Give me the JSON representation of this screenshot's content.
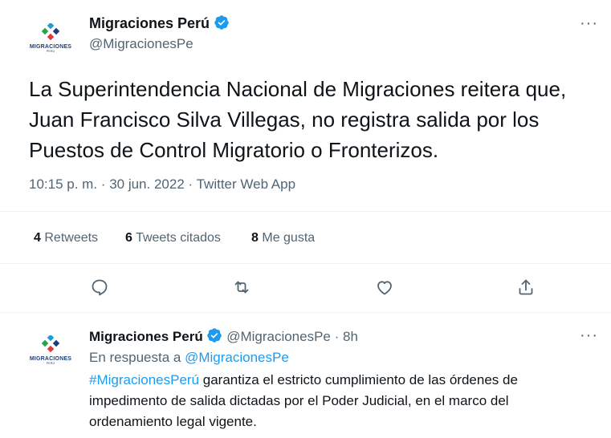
{
  "tweet": {
    "author_name": "Migraciones Perú",
    "author_handle": "@MigracionesPe",
    "avatar_text": "MIGRACIONES",
    "avatar_sub": "PERÚ",
    "text": "La Superintendencia Nacional de Migraciones reitera que, Juan Francisco Silva Villegas, no registra salida por los Puestos de Control Migratorio o Fronterizos.",
    "time": "10:15 p. m.",
    "date": "30 jun. 2022",
    "source": "Twitter Web App",
    "more_label": "···",
    "stats": {
      "retweets_count": "4",
      "retweets_label": "Retweets",
      "quotes_count": "6",
      "quotes_label": "Tweets citados",
      "likes_count": "8",
      "likes_label": "Me gusta"
    }
  },
  "reply": {
    "author_name": "Migraciones Perú",
    "author_handle": "@MigracionesPe",
    "age": "8h",
    "in_reply_prefix": "En respuesta a",
    "in_reply_handle": "@MigracionesPe",
    "hashtag": "#MigracionesPerú",
    "text": "garantiza el estricto cumplimiento de las órdenes de impedimento de salida dictadas por el Poder Judicial, en el marco del ordenamiento legal vigente.",
    "more_label": "···"
  },
  "colors": {
    "accent": "#1d9bf0",
    "muted": "#536471",
    "text": "#0f1419",
    "divider": "#eff3f4"
  },
  "icons": [
    "reply-icon",
    "retweet-icon",
    "like-icon",
    "share-icon",
    "verified-icon",
    "more-icon"
  ]
}
